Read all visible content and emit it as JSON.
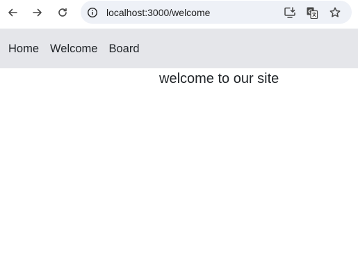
{
  "browser": {
    "url": "localhost:3000/welcome",
    "icons": {
      "back": "arrow-left-icon",
      "forward": "arrow-right-icon",
      "reload": "reload-icon",
      "site_info": "info-icon",
      "install": "install-app-icon",
      "translate": "translate-icon",
      "bookmark": "star-icon"
    }
  },
  "nav": {
    "items": [
      {
        "label": "Home"
      },
      {
        "label": "Welcome"
      },
      {
        "label": "Board"
      }
    ],
    "background": "#e5e6ea"
  },
  "main": {
    "welcome_text": "welcome to our site"
  },
  "colors": {
    "omnibox_bg": "#eef1f7",
    "text": "#212529",
    "icon": "#474747"
  }
}
